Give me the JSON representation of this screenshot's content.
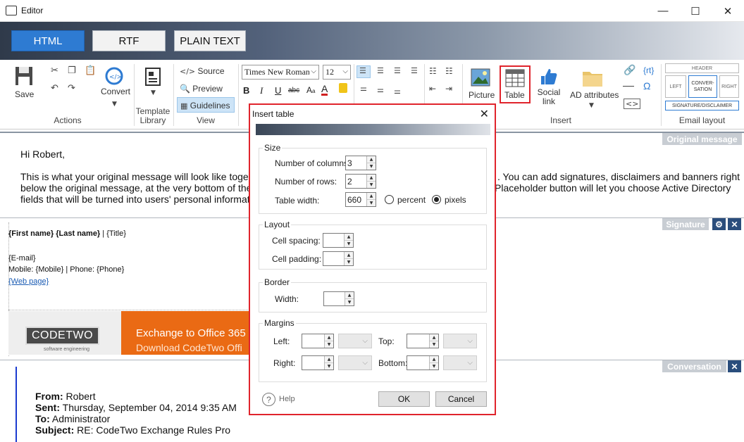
{
  "window": {
    "title": "Editor",
    "minimize": "—",
    "maximize": "☐",
    "close": "✕"
  },
  "format_tabs": [
    "HTML",
    "RTF",
    "PLAIN TEXT"
  ],
  "ribbon": {
    "actions": {
      "save": "Save",
      "convert": "Convert",
      "label": "Actions"
    },
    "template_library": {
      "label": "Template Library"
    },
    "view": {
      "source": "Source",
      "preview": "Preview",
      "guidelines": "Guidelines",
      "label": "View"
    },
    "font": {
      "family": "Times New Roman",
      "size": "12"
    },
    "insert": {
      "picture": "Picture",
      "table": "Table",
      "social_link": "Social link",
      "ad_attributes": "AD attributes",
      "rt": "{rt}",
      "label": "Insert"
    },
    "email_layout": {
      "header": "HEADER",
      "left": "LEFT",
      "conversation": "CONVER-SATION",
      "right": "RIGHT",
      "signature": "SIGNATURE/DISCLAIMER",
      "label": "Email layout"
    }
  },
  "sections": {
    "original_message": "Original message",
    "signature": "Signature",
    "conversation": "Conversation"
  },
  "original_message": {
    "greeting": "Hi Robert,",
    "line1a": "This is what your original message will look like together",
    "line1b": ". You can add signatures, disclaimers and banners right",
    "line2a": "below the original message, at the very bottom of the co",
    "line2b": "Placeholder button will let you choose Active Directory",
    "line3a": "fields that will be turned into users' personal information"
  },
  "signature": {
    "name_line": "{First name} {Last name}",
    "title": " | {Title}",
    "email": "{E-mail}",
    "phone_line": "Mobile: {Mobile} | Phone: {Phone}",
    "web": "{Web page}",
    "logo": "CODETWO",
    "logo_sub": "software engineering",
    "banner_line1": "Exchange to Office 365",
    "banner_line2": "Download CodeTwo Offi"
  },
  "conversation": {
    "from_label": "From:",
    "from": " Robert",
    "sent_label": "Sent:",
    "sent": " Thursday, September 04, 2014 9:35 AM",
    "to_label": "To:",
    "to": " Administrator",
    "subject_label": "Subject:",
    "subject": " RE: CodeTwo Exchange Rules Pro"
  },
  "dialog": {
    "title": "Insert table",
    "size": {
      "legend": "Size",
      "columns_label": "Number of columns:",
      "columns": "3",
      "rows_label": "Number of rows:",
      "rows": "2",
      "width_label": "Table width:",
      "width": "660",
      "percent": "percent",
      "pixels": "pixels"
    },
    "layout": {
      "legend": "Layout",
      "spacing_label": "Cell spacing:",
      "padding_label": "Cell padding:"
    },
    "border": {
      "legend": "Border",
      "width_label": "Width:"
    },
    "margins": {
      "legend": "Margins",
      "left": "Left:",
      "top": "Top:",
      "right": "Right:",
      "bottom": "Bottom:"
    },
    "help": "Help",
    "ok": "OK",
    "cancel": "Cancel"
  },
  "colors": {
    "accent": "#2e7bd2",
    "highlight_red": "#e0242c",
    "banner_orange": "#ea6a14",
    "section_label": "#c8cdd3"
  }
}
